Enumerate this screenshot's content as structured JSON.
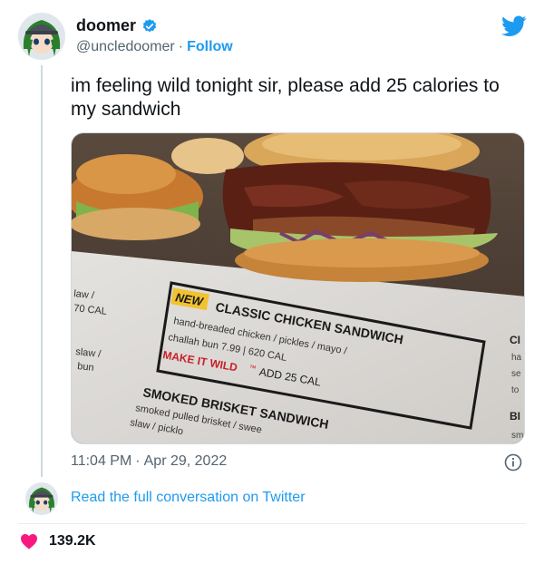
{
  "author": {
    "display_name": "doomer",
    "handle": "@uncledoomer",
    "separator": "·",
    "follow_label": "Follow"
  },
  "tweet": {
    "text": "im feeling wild tonight sir, please add 25 calories to my sandwich"
  },
  "media": {
    "menu": {
      "left_fragment_1": "law /",
      "left_fragment_2": "70 CAL",
      "left_fragment_3": "slaw /",
      "left_fragment_4": "bun",
      "new_badge": "NEW",
      "item1_title": "CLASSIC CHICKEN SANDWICH",
      "item1_desc1": "hand-breaded chicken / pickles / mayo /",
      "item1_desc2": "challah bun 7.99 | 620 CAL",
      "make_it_wild": "MAKE IT WILD",
      "tm": "™",
      "add_cal": "ADD 25 CAL",
      "item2_title": "SMOKED BRISKET SANDWICH",
      "item2_desc1": "smoked pulled brisket / swee",
      "item2_desc2": "slaw / picklo",
      "right_fragment_1": "CI",
      "right_fragment_2": "ha",
      "right_fragment_3": "se",
      "right_fragment_4": "to",
      "right_fragment_5": "BI",
      "right_fragment_6": "sm"
    }
  },
  "meta": {
    "time": "11:04 PM",
    "separator": "·",
    "date": "Apr 29, 2022"
  },
  "conversation_link": "Read the full conversation on Twitter",
  "likes": {
    "count": "139.2K"
  },
  "colors": {
    "accent": "#1d9bf0",
    "heart": "#f91880",
    "secondary_text": "#536471"
  }
}
